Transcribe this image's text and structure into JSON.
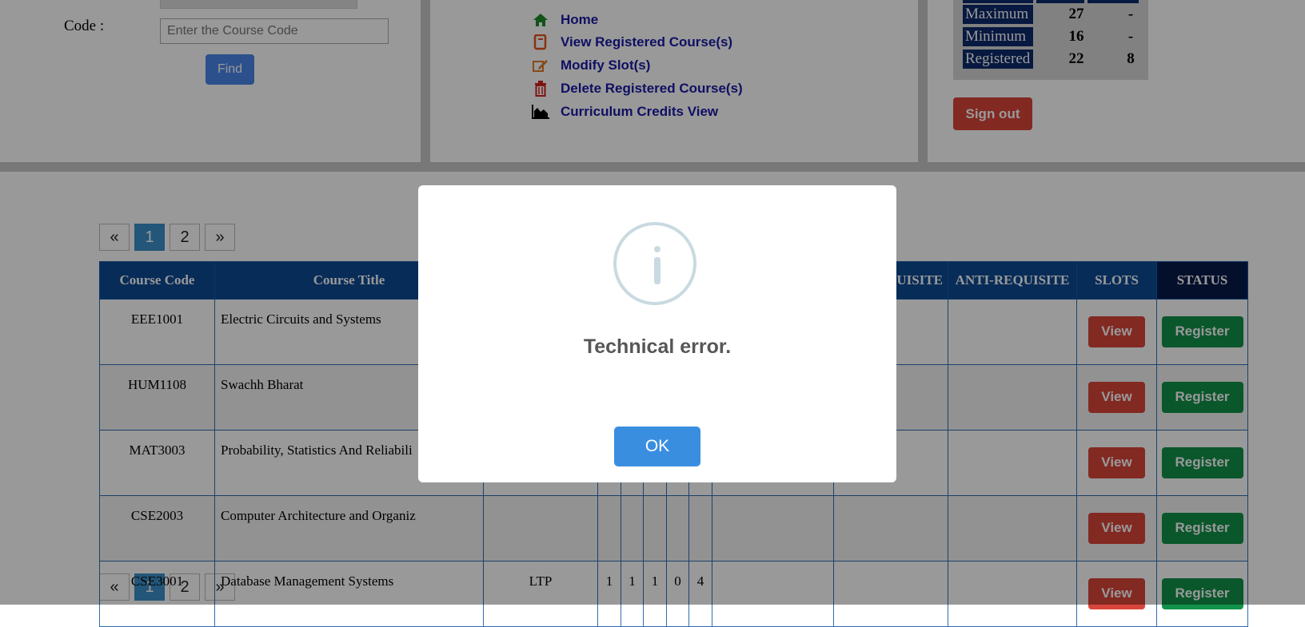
{
  "search": {
    "code_label": "Code :",
    "placeholder": "Enter the Course Code",
    "find_label": "Find"
  },
  "menu": [
    {
      "label": "Home",
      "icon": "home-icon",
      "color": "#1d8a2a"
    },
    {
      "label": "View Registered Course(s)",
      "icon": "book-icon",
      "color": "#e3541f"
    },
    {
      "label": "Modify Slot(s)",
      "icon": "edit-icon",
      "color": "#e07a2d"
    },
    {
      "label": "Delete Registered Course(s)",
      "icon": "trash-icon",
      "color": "#d01f1f"
    },
    {
      "label": "Curriculum Credits View",
      "icon": "area-chart-icon",
      "color": "#000000"
    }
  ],
  "credits": [
    {
      "label": "Maximum",
      "v1": "27",
      "v2": "-"
    },
    {
      "label": "Minimum",
      "v1": "16",
      "v2": "-"
    },
    {
      "label": "Registered",
      "v1": "22",
      "v2": "8"
    }
  ],
  "signout_label": "Sign out",
  "pagination": {
    "prev": "«",
    "pages": [
      "1",
      "2"
    ],
    "next": "»",
    "active": "1"
  },
  "table": {
    "headers": [
      "Course Code",
      "Course Title",
      "",
      "",
      "",
      "",
      "",
      "",
      "UISITE",
      "ANTI-REQUISITE",
      "SLOTS",
      "STATUS"
    ],
    "rows": [
      {
        "code": "EEE1001",
        "title": "Electric Circuits and Systems",
        "type": "",
        "l": "",
        "t": "",
        "p": "",
        "j": "",
        "c": ""
      },
      {
        "code": "HUM1108",
        "title": "Swachh Bharat",
        "type": "",
        "l": "",
        "t": "",
        "p": "",
        "j": "",
        "c": ""
      },
      {
        "code": "MAT3003",
        "title": "Probability, Statistics And Reliabili",
        "type": "",
        "l": "",
        "t": "",
        "p": "",
        "j": "",
        "c": ""
      },
      {
        "code": "CSE2003",
        "title": "Computer Architecture and Organiz",
        "type": "",
        "l": "",
        "t": "",
        "p": "",
        "j": "",
        "c": ""
      },
      {
        "code": "CSE3001",
        "title": "Database Management Systems",
        "type": "LTP",
        "l": "1",
        "t": "1",
        "p": "1",
        "j": "0",
        "c": "4"
      }
    ],
    "view_label": "View",
    "register_label": "Register"
  },
  "dialog": {
    "title": "Technical error.",
    "ok_label": "OK",
    "icon": "info-icon"
  }
}
